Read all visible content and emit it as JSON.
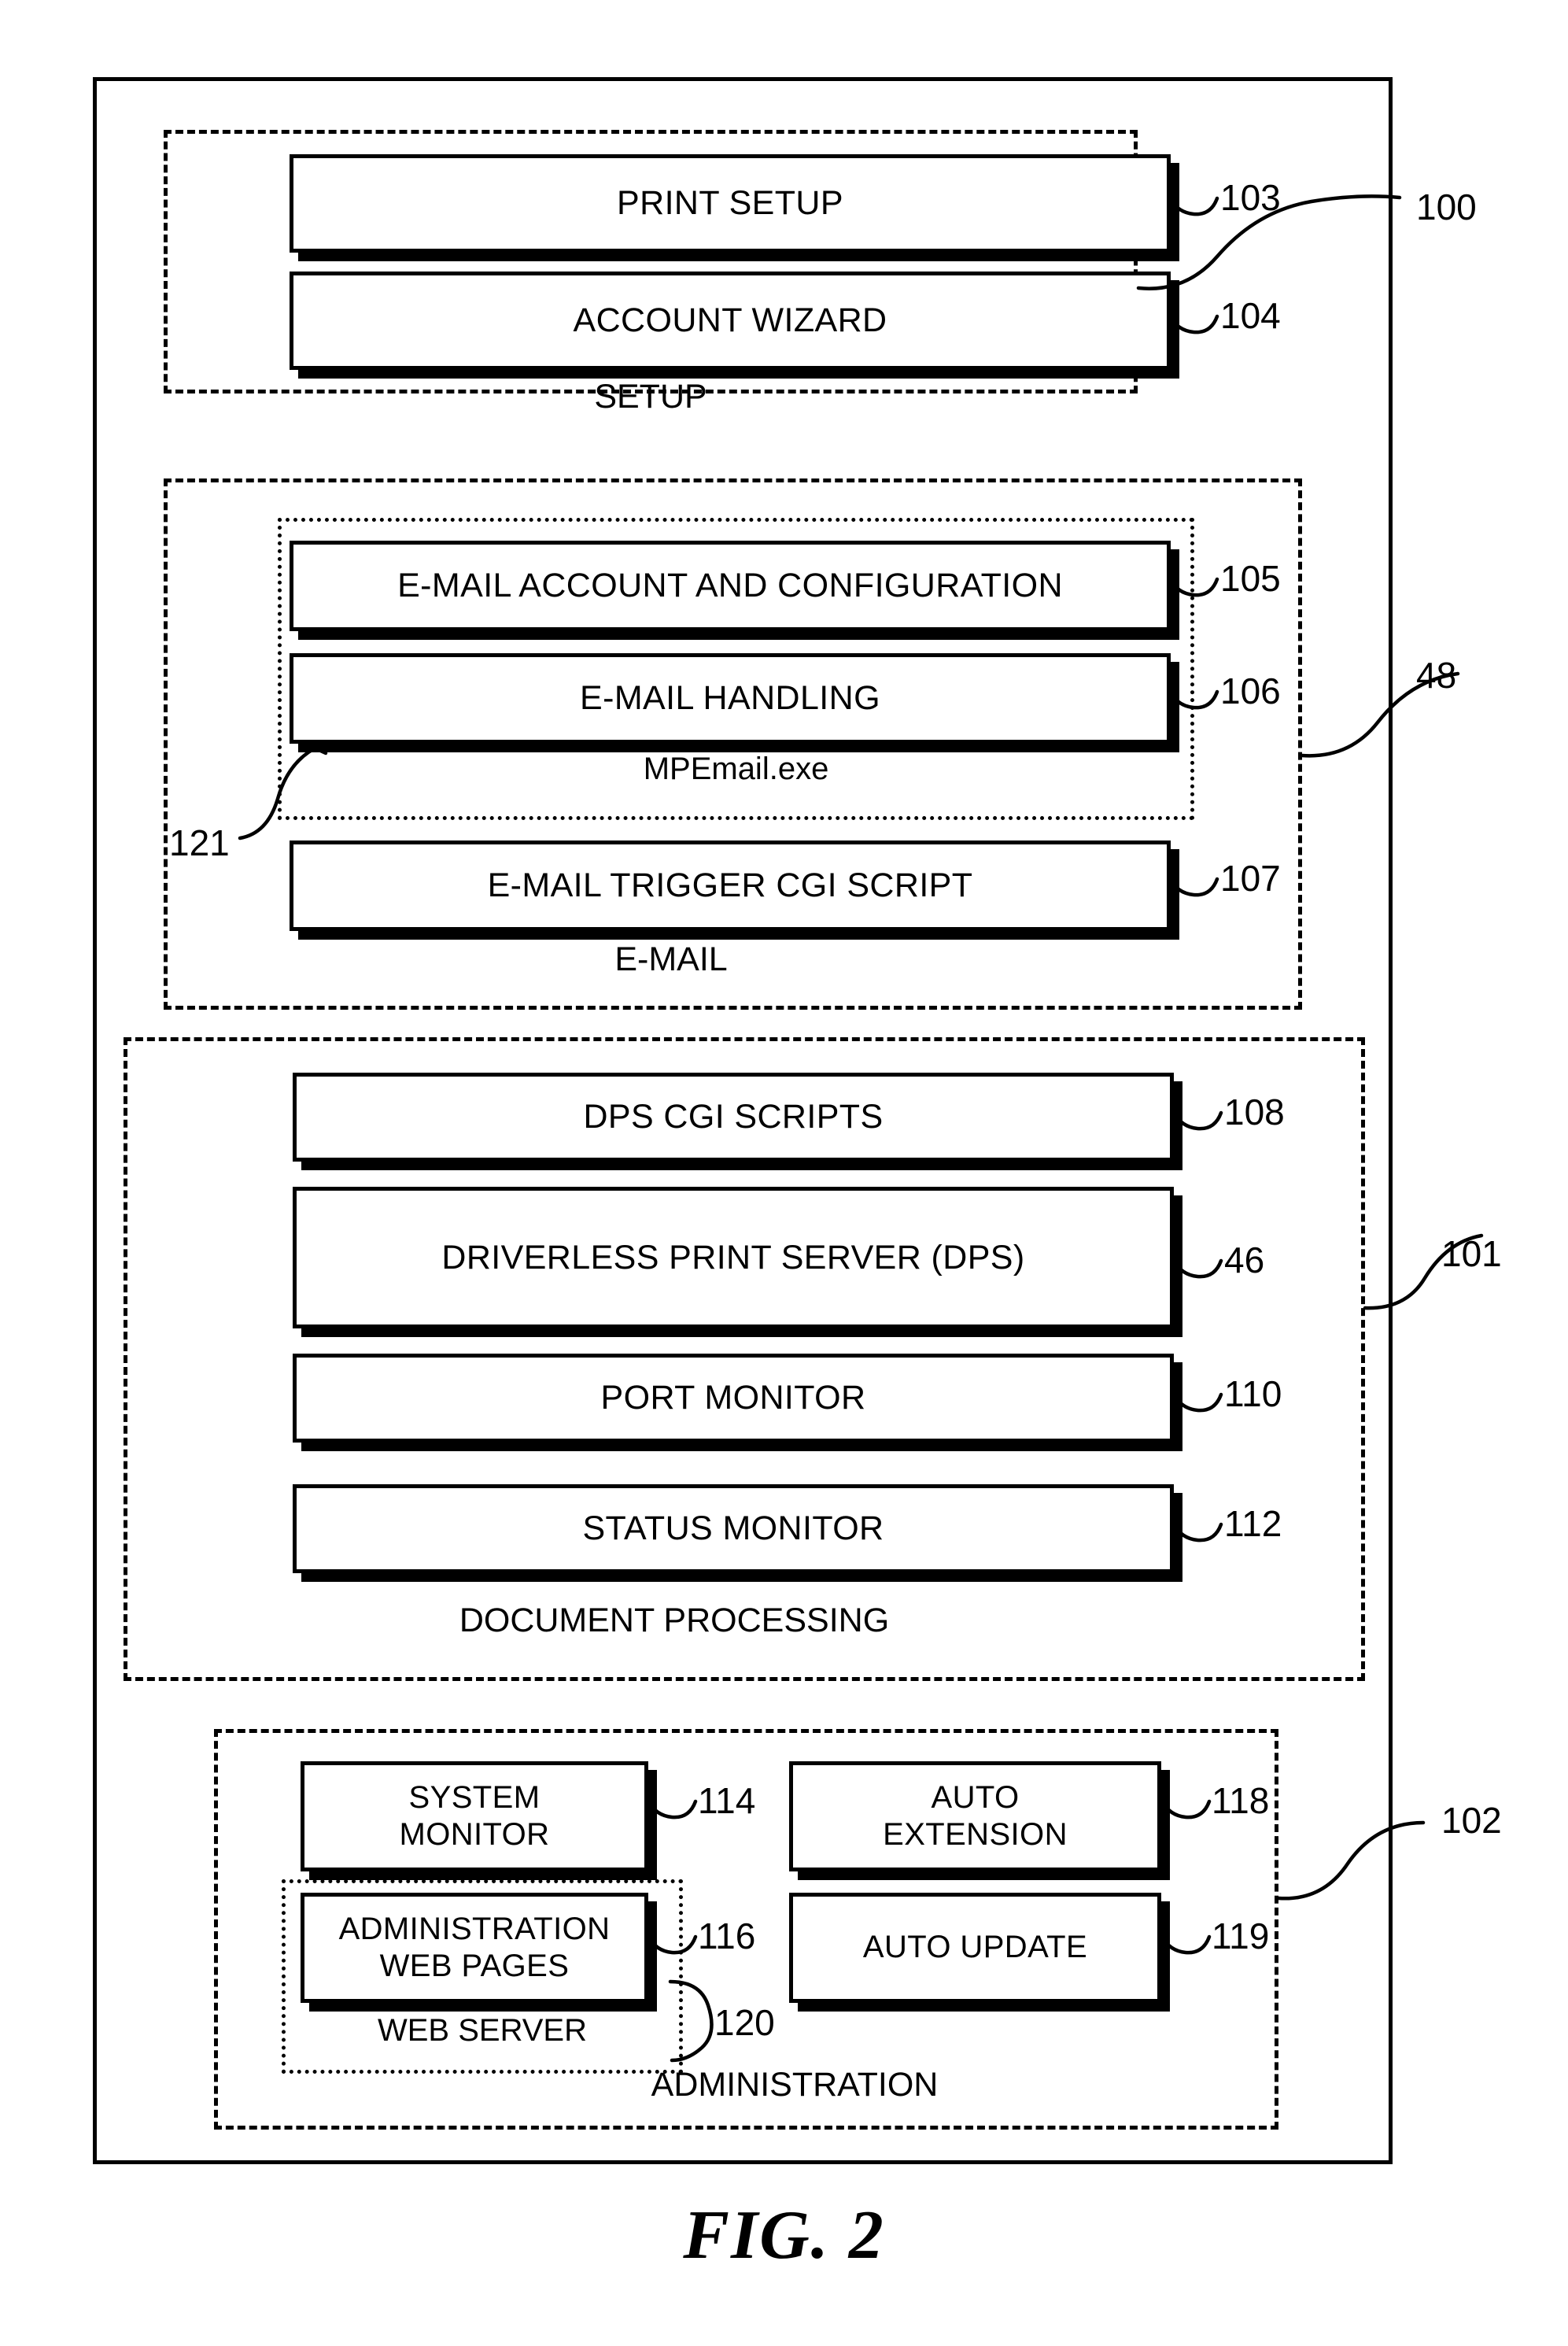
{
  "figure": {
    "caption": "FIG. 2",
    "outer_reference": "100"
  },
  "groups": [
    {
      "id": "setup",
      "caption": "SETUP",
      "reference": "100",
      "nodes": [
        {
          "label": "PRINT SETUP",
          "reference": "103"
        },
        {
          "label": "ACCOUNT WIZARD",
          "reference": "104"
        }
      ]
    },
    {
      "id": "email",
      "caption": "E-MAIL",
      "reference": "48",
      "subgroup": {
        "caption": "MPEmail.exe",
        "reference": "121",
        "nodes": [
          {
            "label": "E-MAIL ACCOUNT AND CONFIGURATION",
            "reference": "105"
          },
          {
            "label": "E-MAIL HANDLING",
            "reference": "106"
          }
        ]
      },
      "nodes": [
        {
          "label": "E-MAIL TRIGGER CGI SCRIPT",
          "reference": "107"
        }
      ]
    },
    {
      "id": "document-processing",
      "caption": "DOCUMENT PROCESSING",
      "reference": "101",
      "nodes": [
        {
          "label": "DPS CGI SCRIPTS",
          "reference": "108"
        },
        {
          "label": "DRIVERLESS PRINT SERVER (DPS)",
          "reference": "46"
        },
        {
          "label": "PORT MONITOR",
          "reference": "110"
        },
        {
          "label": "STATUS MONITOR",
          "reference": "112"
        }
      ]
    },
    {
      "id": "administration",
      "caption": "ADMINISTRATION",
      "reference": "102",
      "subgroup": {
        "caption": "WEB SERVER",
        "reference": "120",
        "nodes": [
          {
            "label": "ADMINISTRATION\nWEB PAGES",
            "reference": "116"
          }
        ]
      },
      "nodes": [
        {
          "label": "SYSTEM\nMONITOR",
          "reference": "114"
        },
        {
          "label": "AUTO\nEXTENSION",
          "reference": "118"
        },
        {
          "label": "AUTO UPDATE",
          "reference": "119"
        }
      ]
    }
  ]
}
